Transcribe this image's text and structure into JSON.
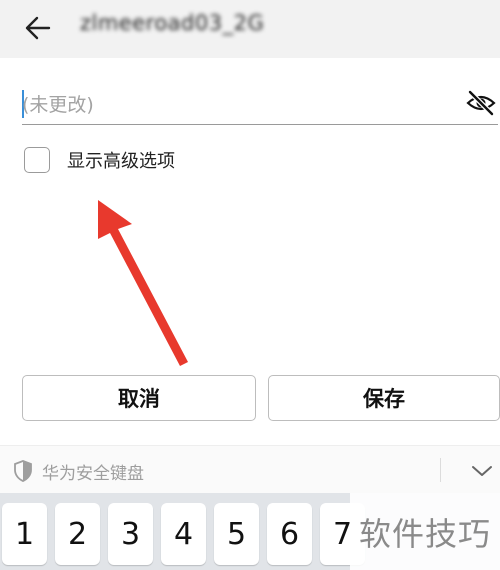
{
  "header": {
    "network_name": "zlmeeroad03_2G"
  },
  "password": {
    "placeholder": "(未更改)"
  },
  "advanced": {
    "label": "显示高级选项"
  },
  "buttons": {
    "cancel": "取消",
    "save": "保存"
  },
  "keyboard": {
    "title": "华为安全键盘",
    "keys": [
      "1",
      "2",
      "3",
      "4",
      "5",
      "6",
      "7"
    ]
  },
  "watermark": "软件技巧",
  "colors": {
    "annotation_arrow": "#e8392d",
    "caret": "#3a8fd8"
  }
}
